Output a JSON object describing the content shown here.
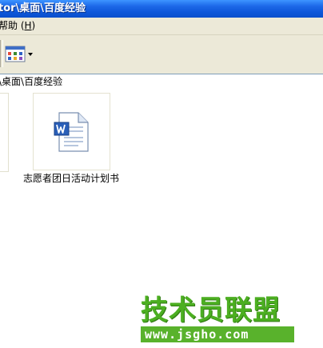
{
  "window": {
    "title": "tor\\桌面\\百度经验"
  },
  "menu": {
    "help_prefix": "帮助 (",
    "help_accel": "H",
    "help_suffix": ")"
  },
  "toolbar": {
    "views_icon": "views-grid-icon"
  },
  "address": {
    "path": "\\桌面\\百度经验"
  },
  "files": [
    {
      "name": "志愿者团日活动计划书",
      "icon": "word-document-icon"
    }
  ],
  "watermark": {
    "name": "技术员联盟",
    "url": "www.jsgho.com"
  },
  "colors": {
    "titlebar": "#0d56d9",
    "chrome": "#ece9d8",
    "watermark_green": "#4caf21"
  }
}
